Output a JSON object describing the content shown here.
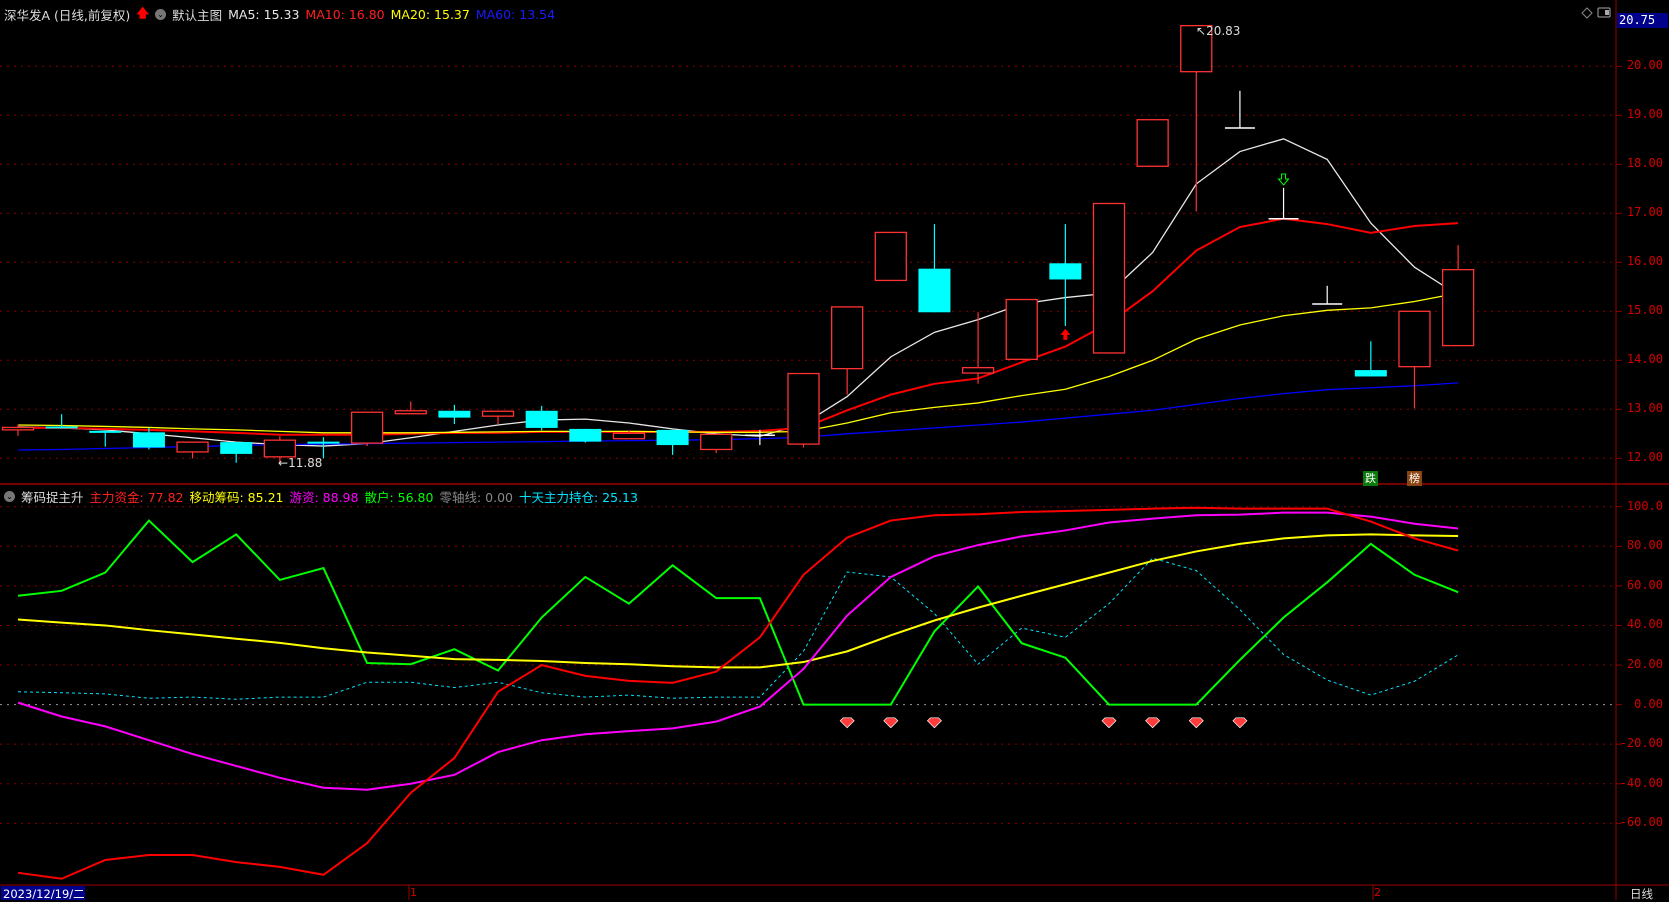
{
  "header": {
    "stock_title": "深华发A (日线,前复权)",
    "main_chart_label": "默认主图",
    "ma5": "MA5: 15.33",
    "ma10": "MA10: 16.80",
    "ma20": "MA20: 15.37",
    "ma60": "MA60: 13.54"
  },
  "indicator_header": {
    "name": "筹码捉主升",
    "zhuli": "主力资金: 77.82",
    "yidong": "移动筹码: 85.21",
    "youzi": "游资: 88.98",
    "sanhu": "散户: 56.80",
    "zero": "零轴线: 0.00",
    "shitian": "十天主力持仓: 25.13"
  },
  "price_axis": {
    "current": "20.75",
    "ticks": [
      "20.00",
      "19.00",
      "18.00",
      "17.00",
      "16.00",
      "15.00",
      "14.00",
      "13.00",
      "12.00"
    ]
  },
  "indicator_axis": {
    "ticks": [
      "100.0",
      "80.00",
      "60.00",
      "40.00",
      "20.00",
      "0.00",
      "-20.00",
      "-40.00",
      "-60.00"
    ]
  },
  "annotations": {
    "high": "20.83",
    "low": "11.88",
    "badge_die": "跌",
    "badge_bang": "榜"
  },
  "footer": {
    "date": "2023/12/19/二",
    "month1": "1",
    "month2": "2",
    "period": "日线"
  },
  "colors": {
    "up": "#ff3232",
    "down": "#00ffff",
    "ma5": "#e8e8e8",
    "ma10": "#ff0000",
    "ma20": "#ffff00",
    "ma60": "#0000ff",
    "grid": "#8b0000",
    "green": "#00ff00",
    "magenta": "#ff00ff"
  },
  "chart_data": {
    "type": "candlestick",
    "price_ylim": [
      11.5,
      21
    ],
    "candles": [
      [
        12.58,
        12.69,
        12.46,
        12.63
      ],
      [
        12.65,
        12.9,
        12.61,
        12.61
      ],
      [
        12.56,
        12.56,
        12.24,
        12.54
      ],
      [
        12.53,
        12.62,
        12.18,
        12.22
      ],
      [
        12.13,
        12.33,
        12.0,
        12.33
      ],
      [
        12.33,
        12.33,
        11.91,
        12.09
      ],
      [
        12.03,
        12.45,
        11.88,
        12.37
      ],
      [
        12.34,
        12.43,
        12.0,
        12.3
      ],
      [
        12.31,
        12.94,
        12.25,
        12.94
      ],
      [
        12.91,
        13.16,
        12.91,
        12.97
      ],
      [
        12.97,
        13.09,
        12.7,
        12.83
      ],
      [
        12.86,
        12.96,
        12.7,
        12.96
      ],
      [
        12.97,
        13.07,
        12.57,
        12.62
      ],
      [
        12.6,
        12.6,
        12.32,
        12.34
      ],
      [
        12.4,
        12.57,
        12.4,
        12.51
      ],
      [
        12.58,
        12.58,
        12.07,
        12.27
      ],
      [
        12.18,
        12.49,
        12.11,
        12.49
      ],
      [
        12.47,
        12.58,
        12.27,
        12.47
      ],
      [
        12.29,
        13.73,
        12.22,
        13.73
      ],
      [
        13.83,
        15.09,
        13.3,
        15.09
      ],
      [
        15.63,
        16.61,
        15.63,
        16.61
      ],
      [
        15.87,
        16.78,
        14.98,
        14.98
      ],
      [
        13.74,
        14.98,
        13.52,
        13.85
      ],
      [
        14.02,
        15.24,
        14.02,
        15.24
      ],
      [
        15.98,
        16.78,
        14.7,
        15.65
      ],
      [
        14.15,
        17.2,
        14.15,
        17.2
      ],
      [
        17.96,
        18.91,
        17.96,
        18.91
      ],
      [
        19.89,
        20.83,
        17.04,
        20.83
      ],
      [
        18.74,
        19.5,
        18.74,
        18.74
      ],
      [
        16.89,
        17.52,
        16.89,
        16.89
      ],
      [
        15.15,
        15.52,
        15.15,
        15.15
      ],
      [
        13.8,
        14.39,
        13.67,
        13.67
      ],
      [
        13.87,
        15.0,
        13.02,
        15.0
      ],
      [
        14.3,
        16.35,
        14.3,
        15.85
      ]
    ],
    "ma": {
      "ma5": [
        12.64,
        12.62,
        12.58,
        12.5,
        12.42,
        12.33,
        12.28,
        12.25,
        12.3,
        12.42,
        12.55,
        12.68,
        12.78,
        12.8,
        12.72,
        12.6,
        12.5,
        12.45,
        12.7,
        13.26,
        14.07,
        14.57,
        14.83,
        15.15,
        15.28,
        15.37,
        16.2,
        17.6,
        18.26,
        18.52,
        18.1,
        16.8,
        15.9,
        15.33
      ],
      "ma10": [
        12.62,
        12.62,
        12.6,
        12.58,
        12.55,
        12.52,
        12.48,
        12.48,
        12.48,
        12.5,
        12.52,
        12.52,
        12.54,
        12.54,
        12.54,
        12.54,
        12.54,
        12.56,
        12.62,
        12.98,
        13.3,
        13.52,
        13.63,
        13.96,
        14.28,
        14.76,
        15.41,
        16.24,
        16.72,
        16.89,
        16.78,
        16.6,
        16.74,
        16.8
      ],
      "ma20": [
        12.68,
        12.67,
        12.65,
        12.63,
        12.6,
        12.58,
        12.55,
        12.52,
        12.52,
        12.52,
        12.53,
        12.54,
        12.55,
        12.55,
        12.55,
        12.54,
        12.53,
        12.53,
        12.55,
        12.72,
        12.93,
        13.04,
        13.13,
        13.28,
        13.41,
        13.67,
        14.0,
        14.43,
        14.72,
        14.91,
        15.02,
        15.07,
        15.2,
        15.37
      ],
      "ma60": [
        12.17,
        12.18,
        12.2,
        12.22,
        12.24,
        12.26,
        12.28,
        12.29,
        12.3,
        12.31,
        12.32,
        12.33,
        12.34,
        12.35,
        12.36,
        12.37,
        12.38,
        12.4,
        12.43,
        12.5,
        12.56,
        12.62,
        12.68,
        12.74,
        12.82,
        12.9,
        12.98,
        13.1,
        13.22,
        13.32,
        13.4,
        13.44,
        13.48,
        13.54
      ]
    },
    "signals": {
      "buy_arrow_index": 24,
      "buy_arrow_price": 14.52,
      "sell_arrow_index": 29,
      "sell_arrow_price": 17.7
    },
    "indicator": {
      "ylim": [
        -80,
        105
      ],
      "zhuli": [
        -85,
        -88,
        -78.5,
        -76,
        -76,
        -79.6,
        -82,
        -86,
        -70,
        -44.6,
        -27,
        6.5,
        20,
        14.5,
        12,
        11,
        16.7,
        34,
        65.6,
        84.4,
        93,
        95.7,
        96.2,
        97.3,
        97.8,
        98.4,
        99,
        99.5,
        99,
        99,
        99,
        92.5,
        84,
        77.82
      ],
      "youzi": [
        1,
        -6,
        -11,
        -18,
        -25,
        -31,
        -37,
        -42,
        -43,
        -40,
        -35.5,
        -24,
        -18,
        -15,
        -13.4,
        -12,
        -8.6,
        -1,
        18,
        45,
        64.5,
        75,
        80.6,
        85,
        88,
        92,
        94,
        95.7,
        96,
        97,
        97,
        95,
        91.4,
        88.98
      ],
      "yidong": [
        43,
        41.4,
        40,
        37.6,
        35.5,
        33.3,
        31.2,
        28.5,
        26.3,
        24.7,
        23,
        22.6,
        22,
        21,
        20.4,
        19.4,
        18.8,
        18.8,
        21.5,
        26.9,
        35,
        42.5,
        49,
        55,
        60.8,
        66.7,
        72.6,
        77.4,
        81.2,
        84,
        85.5,
        86,
        85.5,
        85.21
      ],
      "sanhu": [
        55,
        57.5,
        66.7,
        93,
        72,
        86,
        63,
        69,
        21,
        20.4,
        28,
        17.2,
        44,
        64.5,
        51,
        70.4,
        53.8,
        53.8,
        0,
        0,
        0,
        37,
        59.7,
        31,
        23.7,
        0,
        0,
        0,
        22.6,
        44,
        61.8,
        81.2,
        65.6,
        56.8
      ],
      "shitian": [
        6.5,
        6,
        5.4,
        3.2,
        3.8,
        2.7,
        3.8,
        3.8,
        11.3,
        11.3,
        8.6,
        11.3,
        6,
        3.8,
        4.8,
        3.2,
        3.8,
        3.8,
        27,
        67,
        64.5,
        46,
        20.4,
        38.7,
        34,
        51,
        74,
        67.7,
        48,
        25.3,
        12.4,
        4.8,
        11.8,
        25.13
      ],
      "gem_markers": [
        19,
        20,
        21,
        25,
        26,
        27,
        28
      ],
      "gem_value": -9.7
    }
  }
}
